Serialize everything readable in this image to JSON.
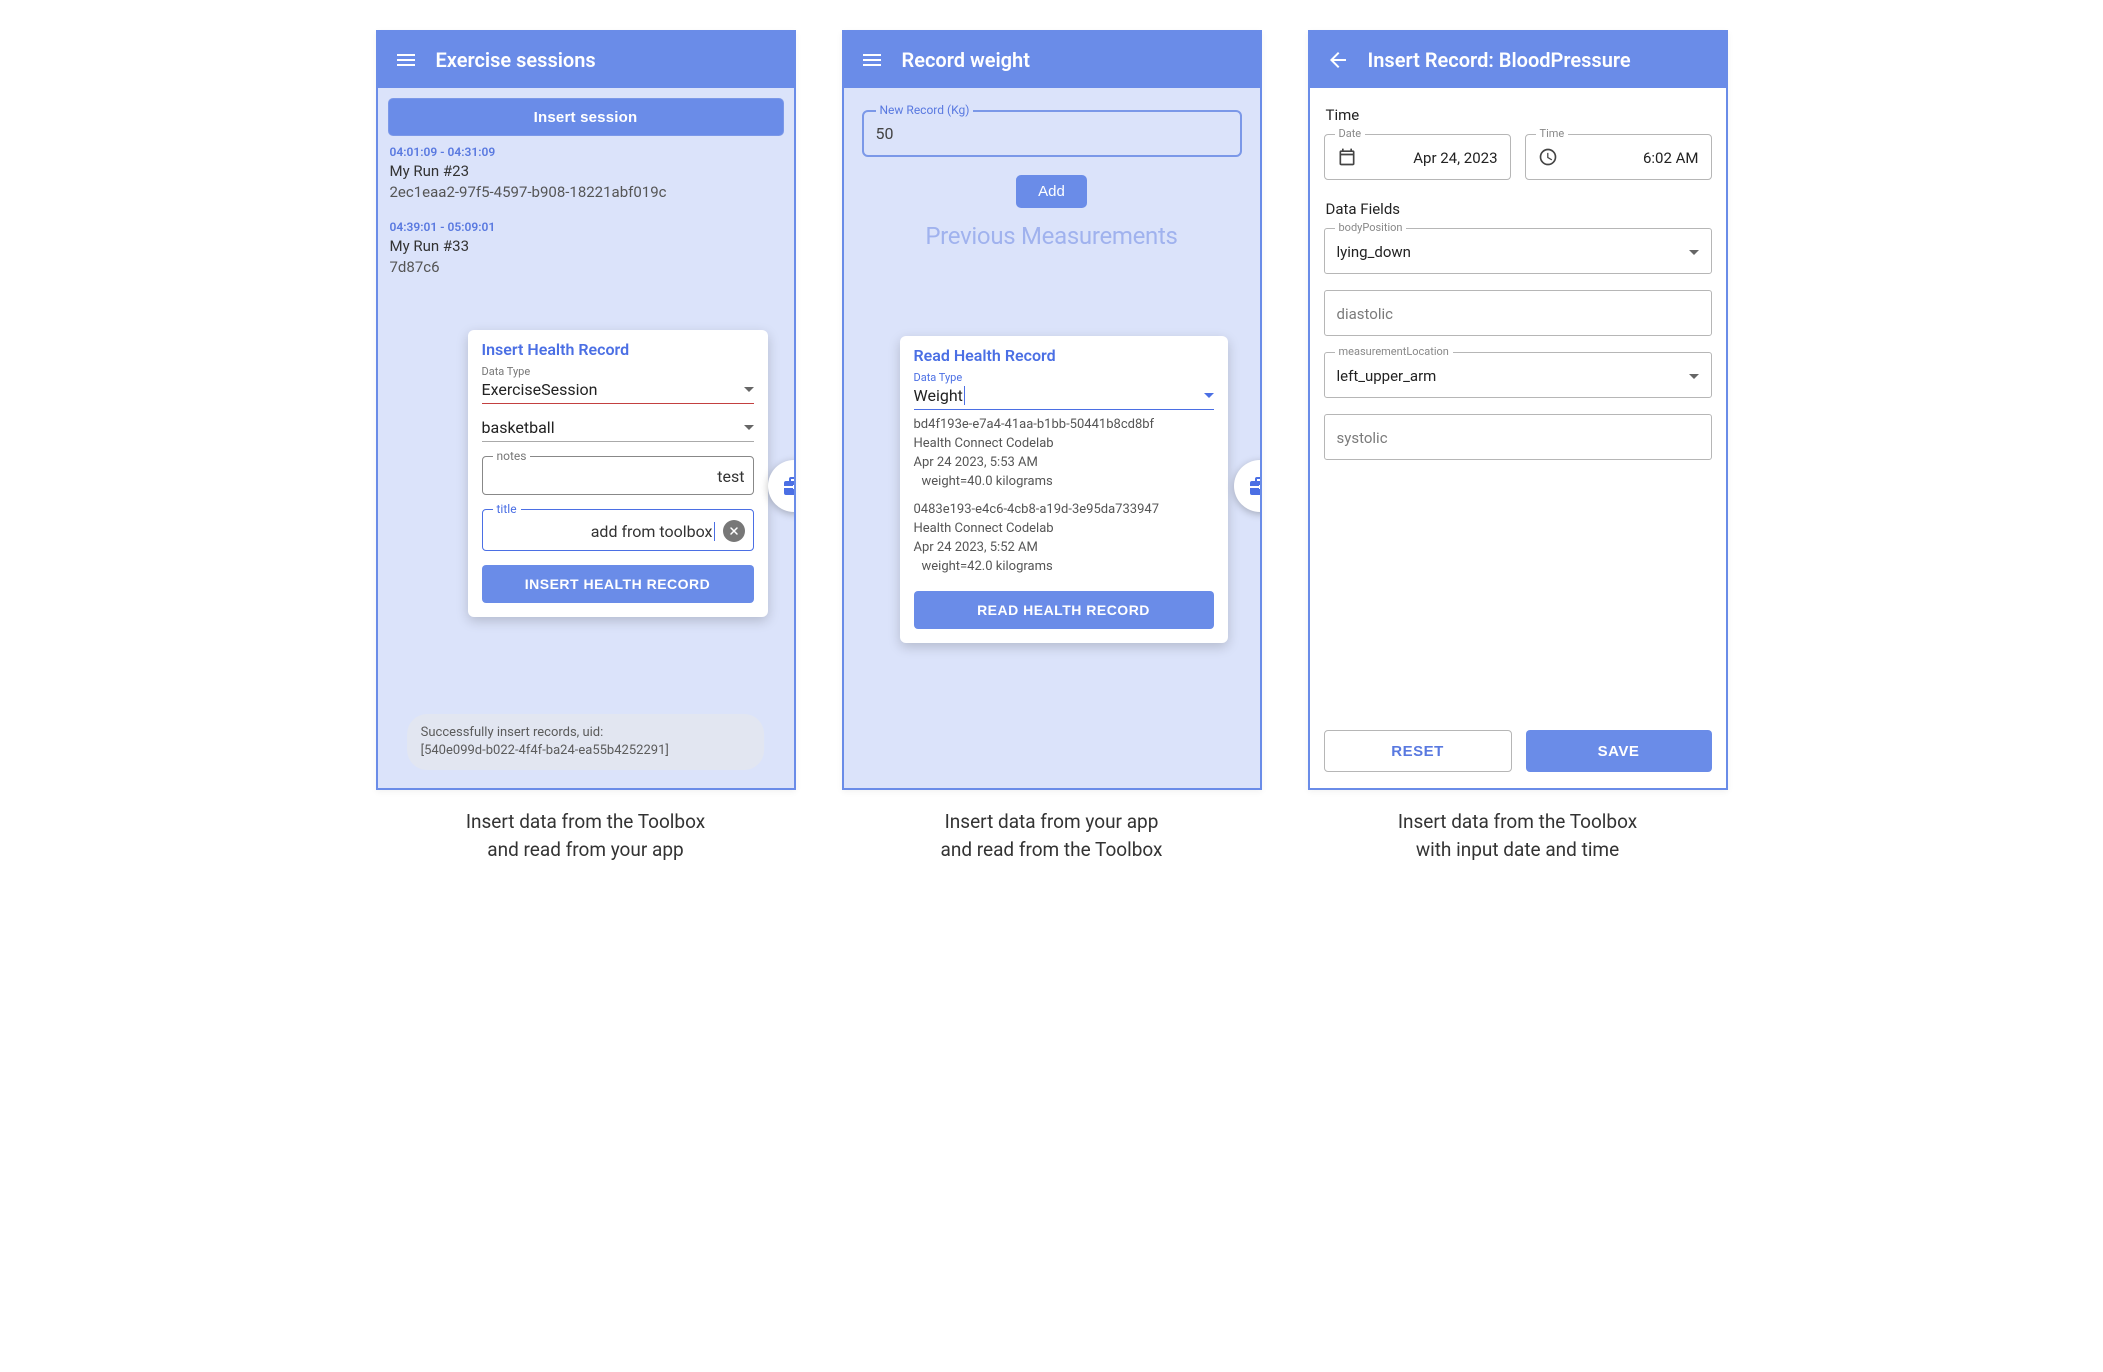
{
  "screen1": {
    "appbar_title": "Exercise sessions",
    "insert_session_label": "Insert session",
    "sessions": [
      {
        "time": "04:01:09 - 04:31:09",
        "name": "My Run #23",
        "uid": "2ec1eaa2-97f5-4597-b908-18221abf019c"
      },
      {
        "time": "04:39:01 - 05:09:01",
        "name": "My Run #33",
        "uid": "7d87c6"
      }
    ],
    "toast_line1": "Successfully insert records, uid:",
    "toast_line2": "[540e099d-b022-4f4f-ba24-ea55b4252291]",
    "card": {
      "title": "Insert Health Record",
      "datatype_label": "Data Type",
      "datatype_value": "ExerciseSession",
      "exercise_value": "basketball",
      "notes_label": "notes",
      "notes_value": "test",
      "title_label": "title",
      "title_value": "add from toolbox",
      "submit_label": "INSERT HEALTH RECORD"
    },
    "caption_line1": "Insert data from the Toolbox",
    "caption_line2": "and read from your app"
  },
  "screen2": {
    "appbar_title": "Record weight",
    "new_record_label": "New Record (Kg)",
    "new_record_value": "50",
    "add_label": "Add",
    "prev_heading": "Previous Measurements",
    "card": {
      "title": "Read Health Record",
      "datatype_label": "Data Type",
      "datatype_value": "Weight",
      "records": [
        {
          "uid": "bd4f193e-e7a4-41aa-b1bb-50441b8cd8bf",
          "app": "Health Connect Codelab",
          "ts": "Apr 24 2023, 5:53 AM",
          "val": "weight=40.0 kilograms"
        },
        {
          "uid": "0483e193-e4c6-4cb8-a19d-3e95da733947",
          "app": "Health Connect Codelab",
          "ts": "Apr 24 2023, 5:52 AM",
          "val": "weight=42.0 kilograms"
        }
      ],
      "submit_label": "READ HEALTH RECORD"
    },
    "caption_line1": "Insert data from your app",
    "caption_line2": "and read from the Toolbox"
  },
  "screen3": {
    "appbar_title": "Insert Record: BloodPressure",
    "time_section": "Time",
    "date_label": "Date",
    "date_value": "Apr 24, 2023",
    "time_label": "Time",
    "time_value": "6:02 AM",
    "fields_section": "Data Fields",
    "body_position_label": "bodyPosition",
    "body_position_value": "lying_down",
    "diastolic_placeholder": "diastolic",
    "measurement_loc_label": "measurementLocation",
    "measurement_loc_value": "left_upper_arm",
    "systolic_placeholder": "systolic",
    "reset_label": "RESET",
    "save_label": "SAVE",
    "caption_line1": "Insert data from the Toolbox",
    "caption_line2": "with input date and time"
  }
}
